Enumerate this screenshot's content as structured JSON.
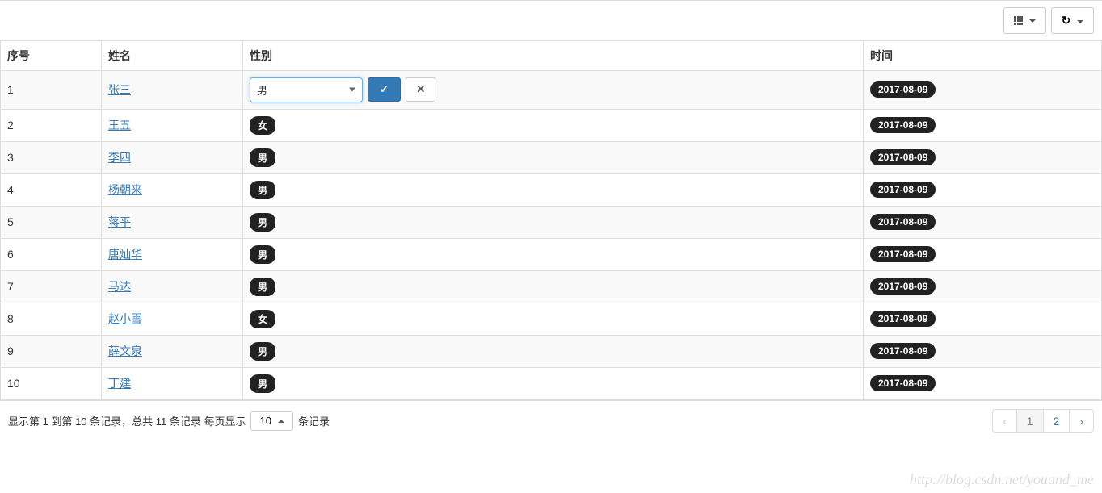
{
  "toolbar": {
    "columns_title": "Columns",
    "export_title": "Export"
  },
  "headers": {
    "index": "序号",
    "name": "姓名",
    "gender": "性别",
    "date": "时间"
  },
  "edit": {
    "selected_gender": "男",
    "confirm_label": "OK",
    "cancel_label": "Cancel"
  },
  "rows": [
    {
      "index": "1",
      "name": "张三",
      "gender": "男",
      "date": "2017-08-09",
      "editing": true
    },
    {
      "index": "2",
      "name": "王五",
      "gender": "女",
      "date": "2017-08-09",
      "editing": false
    },
    {
      "index": "3",
      "name": "李四",
      "gender": "男",
      "date": "2017-08-09",
      "editing": false
    },
    {
      "index": "4",
      "name": "杨朝来",
      "gender": "男",
      "date": "2017-08-09",
      "editing": false
    },
    {
      "index": "5",
      "name": "蒋平",
      "gender": "男",
      "date": "2017-08-09",
      "editing": false
    },
    {
      "index": "6",
      "name": "唐灿华",
      "gender": "男",
      "date": "2017-08-09",
      "editing": false
    },
    {
      "index": "7",
      "name": "马达",
      "gender": "男",
      "date": "2017-08-09",
      "editing": false
    },
    {
      "index": "8",
      "name": "赵小雪",
      "gender": "女",
      "date": "2017-08-09",
      "editing": false
    },
    {
      "index": "9",
      "name": "薛文泉",
      "gender": "男",
      "date": "2017-08-09",
      "editing": false
    },
    {
      "index": "10",
      "name": "丁建",
      "gender": "男",
      "date": "2017-08-09",
      "editing": false
    }
  ],
  "footer": {
    "info_prefix": "显示第 1 到第 10 条记录，总共 11 条记录 每页显示",
    "page_size": "10",
    "info_suffix": "条记录"
  },
  "pagination": {
    "prev": "‹",
    "pages": [
      "1",
      "2"
    ],
    "active_index": 0,
    "next": "›"
  },
  "watermark": "http://blog.csdn.net/youand_me"
}
